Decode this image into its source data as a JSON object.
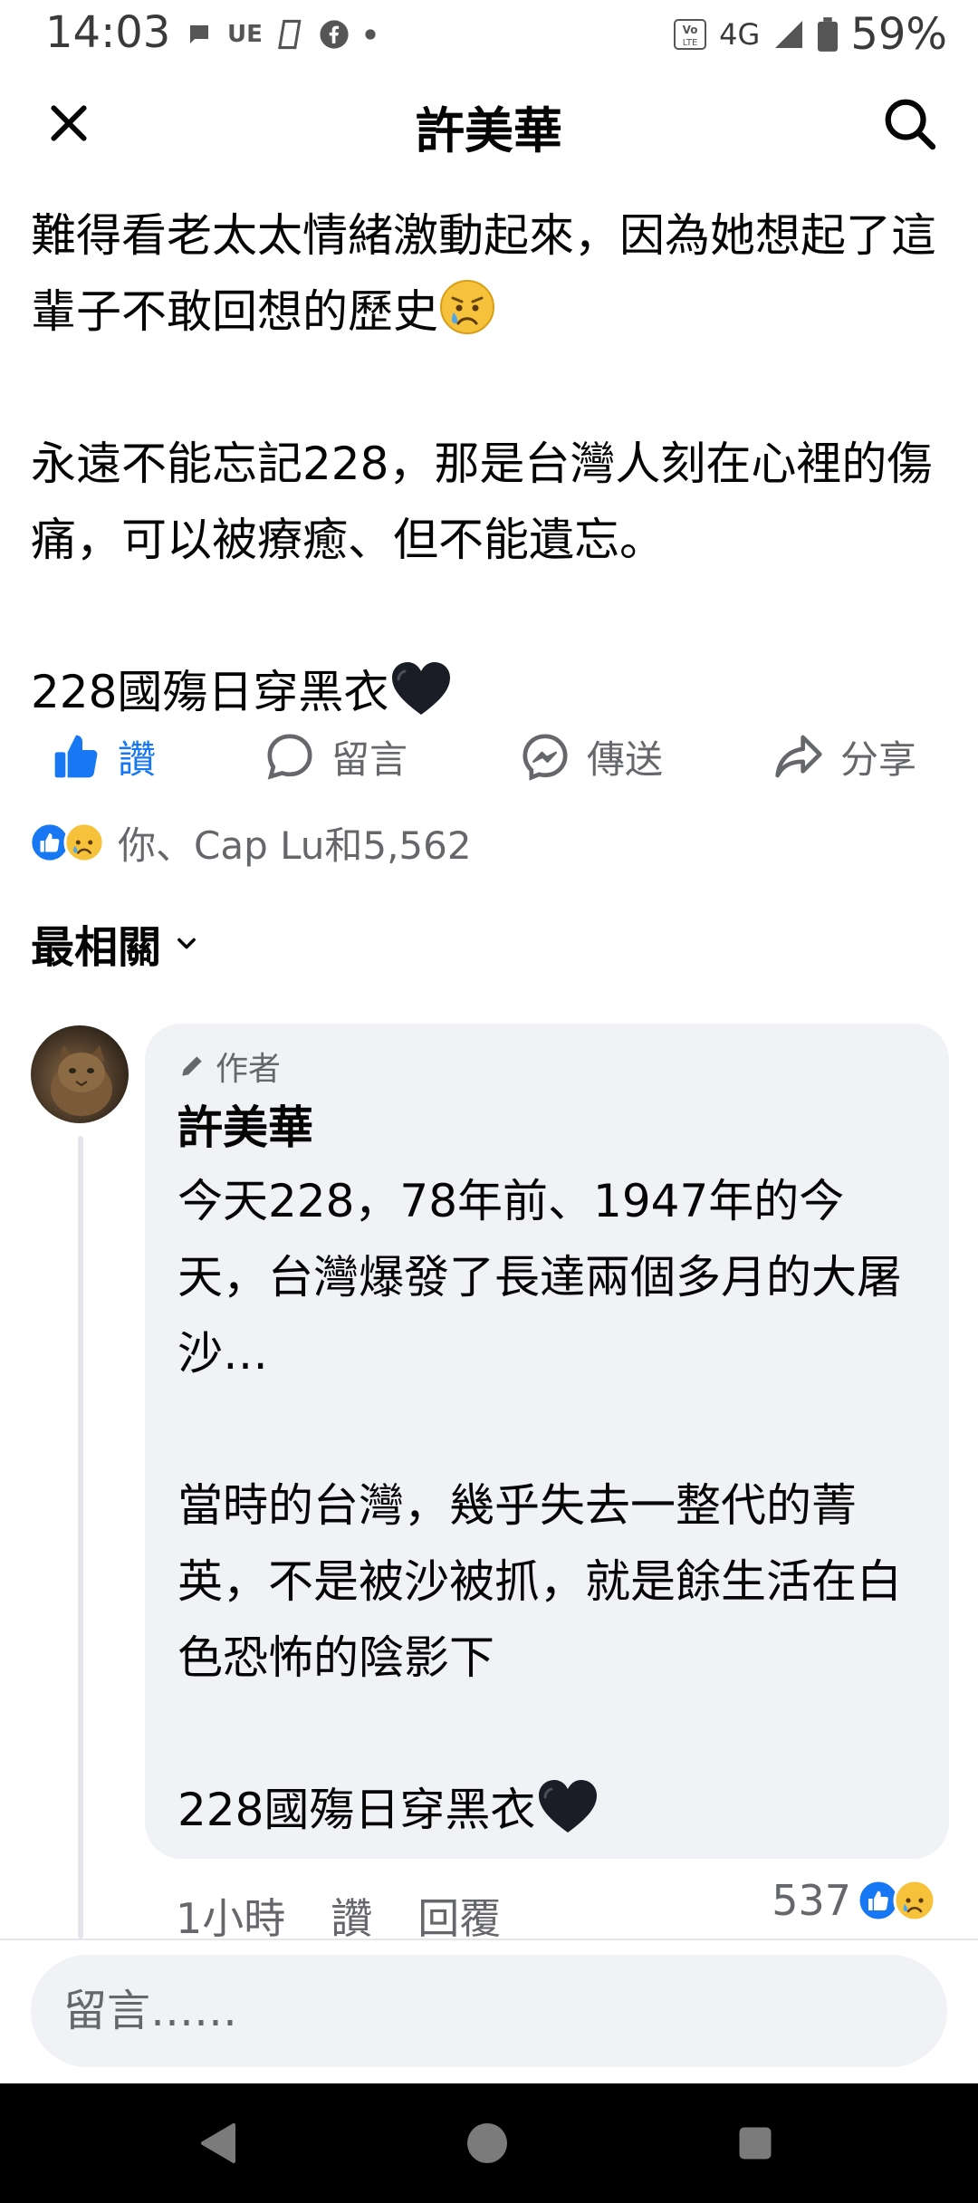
{
  "status_bar": {
    "time": "14:03",
    "carrier_short": "UE",
    "network": "4G",
    "battery": "59%"
  },
  "header": {
    "title": "許美華"
  },
  "post": {
    "paragraphs": [
      "難得看老太太情緒激動起來，因為她想起了這輩子不敢回想的歷史",
      "永遠不能忘記228，那是台灣人刻在心裡的傷痛，可以被療癒、但不能遺忘。",
      "228國殤日穿黑衣"
    ]
  },
  "actions": {
    "like": "讚",
    "comment": "留言",
    "send": "傳送",
    "share": "分享"
  },
  "reactions": {
    "summary": "你、Cap Lu和5,562"
  },
  "sort": {
    "label": "最相關"
  },
  "comment": {
    "badge": "作者",
    "author": "許美華",
    "paragraphs": [
      "今天228，78年前、1947年的今天，台灣爆發了長達兩個多月的大屠沙…",
      "當時的台灣，幾乎失去一整代的菁英，不是被沙被抓，就是餘生活在白色恐怖的陰影下",
      "228國殤日穿黑衣"
    ],
    "time": "1小時",
    "like": "讚",
    "reply": "回覆",
    "reaction_count": "537"
  },
  "input": {
    "placeholder": "留言……"
  },
  "colors": {
    "accent": "#1877f2",
    "secondary_text": "#65676b",
    "bubble": "#f0f2f5"
  },
  "icons": [
    "close-icon",
    "search-icon",
    "like-icon",
    "comment-icon",
    "messenger-icon",
    "share-icon",
    "chevron-down-icon",
    "pencil-icon",
    "back-icon",
    "home-icon",
    "recent-apps-icon"
  ]
}
